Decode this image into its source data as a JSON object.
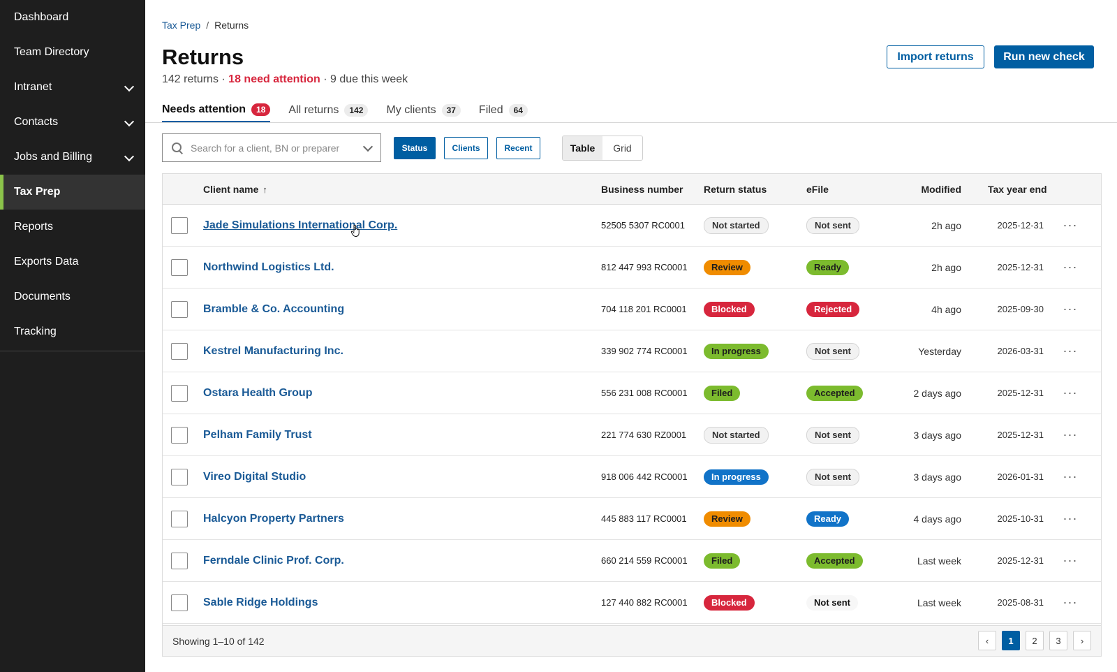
{
  "sidebar": {
    "items": [
      {
        "label": "Dashboard",
        "chevron": false,
        "active": false
      },
      {
        "label": "Team Directory",
        "chevron": false,
        "active": false
      },
      {
        "label": "Intranet",
        "chevron": true,
        "active": false
      },
      {
        "label": "Contacts",
        "chevron": true,
        "active": false
      },
      {
        "label": "Jobs and Billing",
        "chevron": true,
        "active": false
      },
      {
        "label": "Tax Prep",
        "chevron": false,
        "active": true
      },
      {
        "label": "Reports",
        "chevron": false,
        "active": false
      },
      {
        "label": "Exports Data",
        "chevron": false,
        "active": false
      },
      {
        "label": "Documents",
        "chevron": false,
        "active": false
      },
      {
        "label": "Tracking",
        "chevron": false,
        "active": false
      }
    ],
    "accent_color": "#8bc34a"
  },
  "breadcrumb": {
    "parent": "Tax Prep",
    "separator": "/",
    "current": "Returns"
  },
  "header": {
    "title": "Returns",
    "subtitle_count": "142 returns ·",
    "subtitle_attention": "18 need attention",
    "subtitle_due": "· 9 due this week",
    "import_label": "Import returns",
    "run_label": "Run new check"
  },
  "tabs": [
    {
      "label": "Needs attention",
      "count": "18",
      "active": true
    },
    {
      "label": "All returns",
      "count": "142",
      "active": false
    },
    {
      "label": "My clients",
      "count": "37",
      "active": false
    },
    {
      "label": "Filed",
      "count": "64",
      "active": false
    }
  ],
  "toolbar": {
    "search_placeholder": "Search for a client, BN or preparer",
    "filters": [
      "Status",
      "Clients",
      "Recent"
    ],
    "view_table": "Table",
    "view_grid": "Grid"
  },
  "table": {
    "columns": {
      "client_name": "Client name",
      "sort_arrow": "↑",
      "business_number": "Business number",
      "return_status": "Return status",
      "efile": "eFile",
      "modified": "Modified",
      "tax_year_end": "Tax year end"
    },
    "rows": [
      {
        "name": "Jade Simulations International Corp.",
        "bn": "52505 5307 RC0001",
        "status": "Not started",
        "status_style": "neutral",
        "efile": "Not sent",
        "efile_style": "neutral",
        "modified": "2h ago",
        "year_end": "2025-12-31",
        "hover": true
      },
      {
        "name": "Northwind Logistics Ltd.",
        "bn": "812 447 993 RC0001",
        "status": "Review",
        "status_style": "orange",
        "efile": "Ready",
        "efile_style": "green",
        "modified": "2h ago",
        "year_end": "2025-12-31",
        "hover": false
      },
      {
        "name": "Bramble & Co. Accounting",
        "bn": "704 118 201 RC0001",
        "status": "Blocked",
        "status_style": "red",
        "efile": "Rejected",
        "efile_style": "red",
        "modified": "4h ago",
        "year_end": "2025-09-30",
        "hover": false
      },
      {
        "name": "Kestrel Manufacturing Inc.",
        "bn": "339 902 774 RC0001",
        "status": "In progress",
        "status_style": "green",
        "efile": "Not sent",
        "efile_style": "neutral",
        "modified": "Yesterday",
        "year_end": "2026-03-31",
        "hover": false
      },
      {
        "name": "Ostara Health Group",
        "bn": "556 231 008 RC0001",
        "status": "Filed",
        "status_style": "green",
        "efile": "Accepted",
        "efile_style": "green",
        "modified": "2 days ago",
        "year_end": "2025-12-31",
        "hover": false
      },
      {
        "name": "Pelham Family Trust",
        "bn": "221 774 630 RZ0001",
        "status": "Not started",
        "status_style": "neutral",
        "efile": "Not sent",
        "efile_style": "neutral",
        "modified": "3 days ago",
        "year_end": "2025-12-31",
        "hover": false
      },
      {
        "name": "Vireo Digital Studio",
        "bn": "918 006 442 RC0001",
        "status": "In progress",
        "status_style": "blue",
        "efile": "Not sent",
        "efile_style": "neutral",
        "modified": "3 days ago",
        "year_end": "2026-01-31",
        "hover": false
      },
      {
        "name": "Halcyon Property Partners",
        "bn": "445 883 117 RC0001",
        "status": "Review",
        "status_style": "orange",
        "efile": "Ready",
        "efile_style": "blue",
        "modified": "4 days ago",
        "year_end": "2025-10-31",
        "hover": false
      },
      {
        "name": "Ferndale Clinic Prof. Corp.",
        "bn": "660 214 559 RC0001",
        "status": "Filed",
        "status_style": "green",
        "efile": "Accepted",
        "efile_style": "green",
        "modified": "Last week",
        "year_end": "2025-12-31",
        "hover": false
      },
      {
        "name": "Sable Ridge Holdings",
        "bn": "127 440 882 RC0001",
        "status": "Blocked",
        "status_style": "red",
        "efile": "Not sent",
        "efile_style": "plain",
        "modified": "Last week",
        "year_end": "2025-08-31",
        "hover": false
      }
    ],
    "more_glyph": "···"
  },
  "footer": {
    "showing": "Showing 1–10 of 142",
    "prev": "‹",
    "pages": [
      "1",
      "2",
      "3"
    ],
    "current_page": "1",
    "next": "›"
  },
  "colors": {
    "brand_blue": "#005ea2",
    "attention_red": "#d7263d",
    "sidebar_bg": "#1e1e1e"
  }
}
